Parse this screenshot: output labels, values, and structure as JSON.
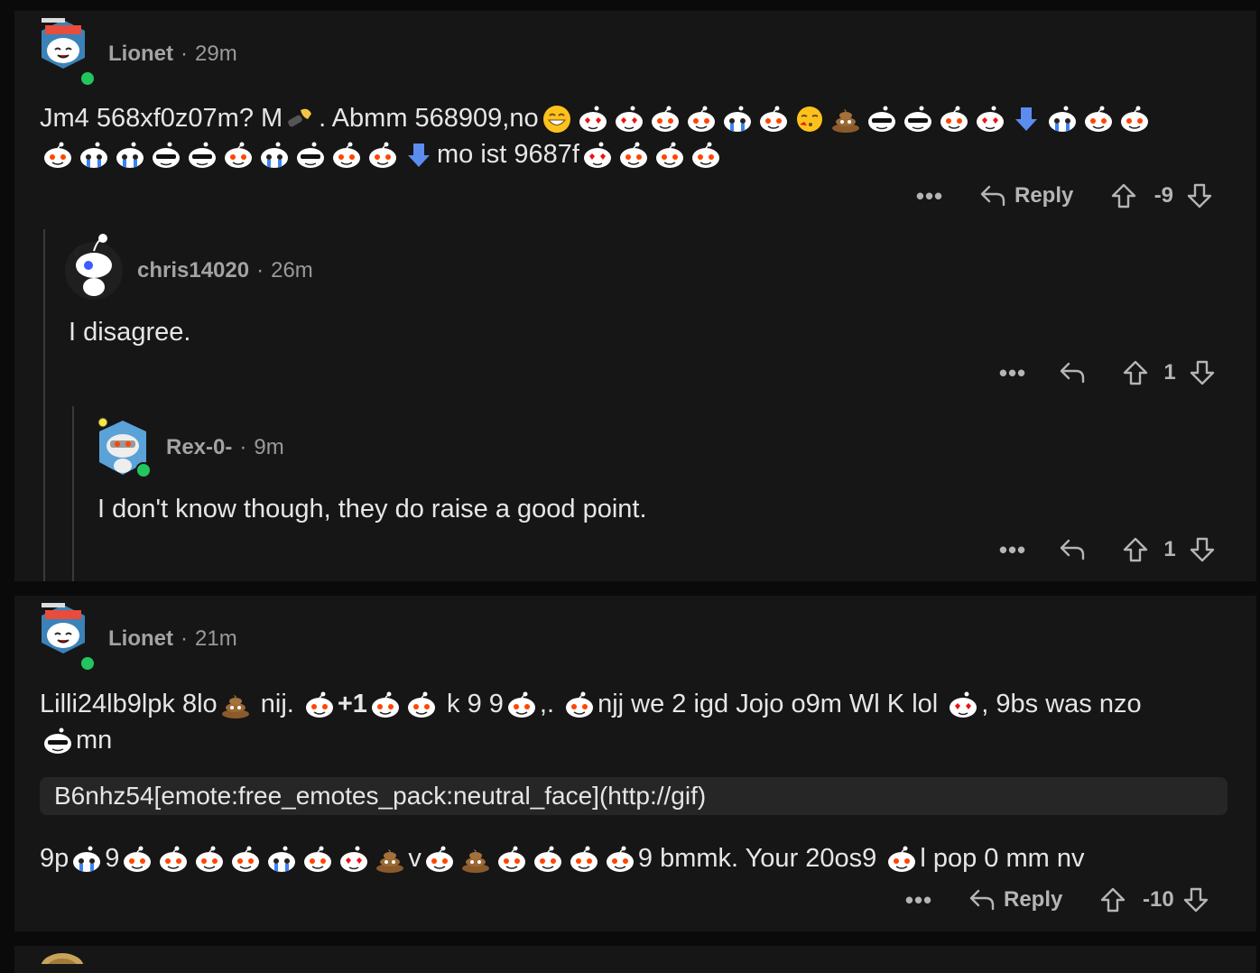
{
  "comments": [
    {
      "user": "Lionet",
      "time": "29m",
      "line1_a": "Jm4 568xf0z07m? M",
      "line1_b": ".  Abmm 568909,no",
      "line2_b": "mo ist 9687f",
      "reply_label": "Reply",
      "score": "-9"
    },
    {
      "user": "chris14020",
      "time": "26m",
      "text": "I disagree.",
      "score": "1"
    },
    {
      "user": "Rex-0-",
      "time": "9m",
      "text": "I don't know though, they do raise a good point.",
      "score": "1"
    },
    {
      "user": "Lionet",
      "time": "21m",
      "line1_a": "Lilli24lb9lpk 8lo",
      "line1_b": " nij. ",
      "line1_plus": "+1",
      "line1_c": " k 9 9",
      "line1_d": ",. ",
      "line1_e": "njj we 2 igd Jojo o9m Wl K lol ",
      "line1_f": ", 9bs was nzo",
      "line2": "mn",
      "code": "B6nhz54[emote:free_emotes_pack:neutral_face](http://gif)",
      "line3_a": "9p",
      "line3_b": "9",
      "line3_c": "v",
      "line3_d": "9 bmmk. Your 20os9 ",
      "line3_e": "l pop 0 mm nv",
      "reply_label": "Reply",
      "score": "-10"
    }
  ],
  "more_label": "•••"
}
